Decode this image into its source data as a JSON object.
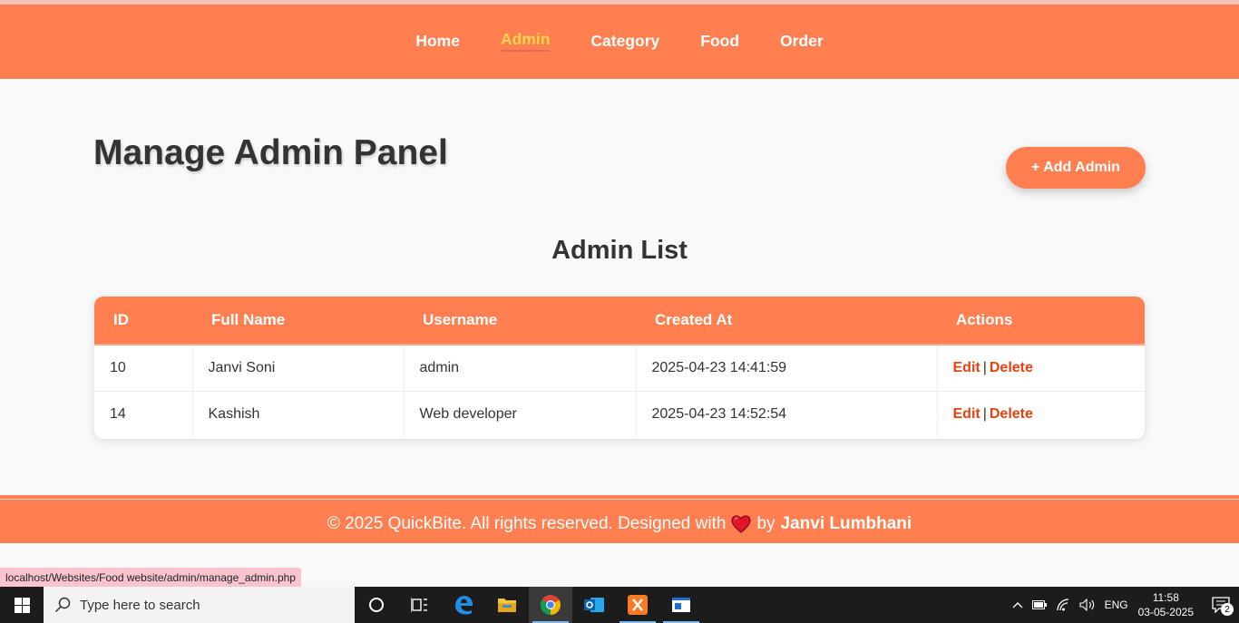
{
  "nav": {
    "items": [
      {
        "label": "Home"
      },
      {
        "label": "Admin"
      },
      {
        "label": "Category"
      },
      {
        "label": "Food"
      },
      {
        "label": "Order"
      }
    ],
    "active": "Admin"
  },
  "page": {
    "title": "Manage Admin Panel",
    "add_button": "+ Add Admin",
    "list_title": "Admin List"
  },
  "table": {
    "columns": [
      "ID",
      "Full Name",
      "Username",
      "Created At",
      "Actions"
    ],
    "rows": [
      {
        "id": "10",
        "full_name": "Janvi Soni",
        "username": "admin",
        "created_at": "2025-04-23 14:41:59",
        "edit": "Edit",
        "sep": "|",
        "delete": "Delete"
      },
      {
        "id": "14",
        "full_name": "Kashish",
        "username": "Web developer",
        "created_at": "2025-04-23 14:52:54",
        "edit": "Edit",
        "sep": "|",
        "delete": "Delete"
      }
    ]
  },
  "footer": {
    "text": "© 2025 QuickBite. All rights reserved. Designed with",
    "by": "by",
    "author": "Janvi Lumbhani"
  },
  "status_bar": {
    "url": "localhost/Websites/Food website/admin/manage_admin.php"
  },
  "taskbar": {
    "search_placeholder": "Type here to search",
    "language": "ENG",
    "time": "11:58",
    "date": "03-05-2025",
    "notification_count": "2"
  },
  "colors": {
    "primary": "#ff7f50",
    "active_nav": "#ffd54f",
    "action": "#e8410e",
    "heading": "#333333"
  }
}
